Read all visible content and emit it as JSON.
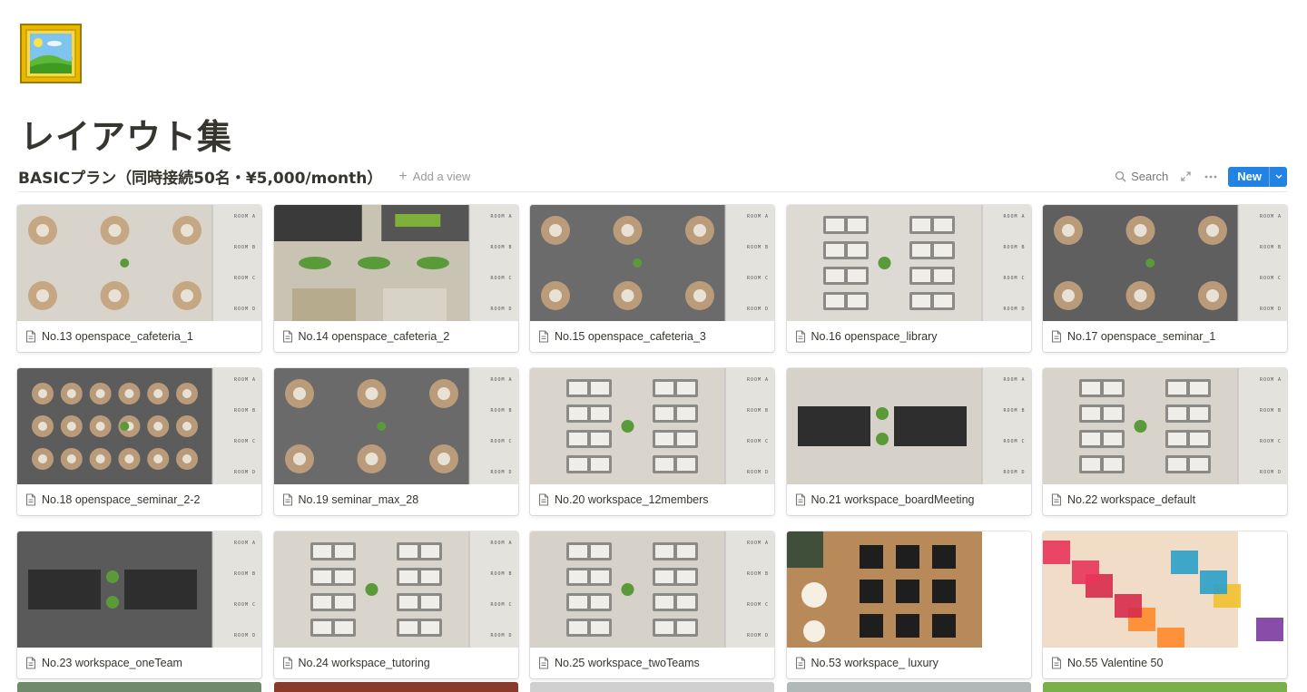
{
  "page": {
    "icon": "framed-picture-icon",
    "title": "レイアウト集"
  },
  "database": {
    "title": "BASICプラン（同時接続50名・¥5,000/month）",
    "add_view_label": "Add a view",
    "toolbar": {
      "search_label": "Search",
      "new_label": "New"
    }
  },
  "room_labels": [
    "ROOM A",
    "ROOM B",
    "ROOM C",
    "ROOM D"
  ],
  "cards": [
    {
      "title": "No.13 openspace_cafeteria_1",
      "floor": "#d8d4cb",
      "style": "tables"
    },
    {
      "title": "No.14 openspace_cafeteria_2",
      "floor": "#c9c3b3",
      "style": "lounge"
    },
    {
      "title": "No.15 openspace_cafeteria_3",
      "floor": "#6b6b6b",
      "style": "tables"
    },
    {
      "title": "No.16 openspace_library",
      "floor": "#dddad3",
      "style": "desks"
    },
    {
      "title": "No.17 openspace_seminar_1",
      "floor": "#5f5f5f",
      "style": "tables"
    },
    {
      "title": "No.18 openspace_seminar_2-2",
      "floor": "#5c5c5c",
      "style": "tables"
    },
    {
      "title": "No.19 seminar_max_28",
      "floor": "#6a6a6a",
      "style": "tables"
    },
    {
      "title": "No.20 workspace_12members",
      "floor": "#d9d5cc",
      "style": "desks"
    },
    {
      "title": "No.21 workspace_boardMeeting",
      "floor": "#d6d2c9",
      "style": "board"
    },
    {
      "title": "No.22 workspace_default",
      "floor": "#d8d4cb",
      "style": "desks"
    },
    {
      "title": "No.23 workspace_oneTeam",
      "floor": "#5a5a5a",
      "style": "board"
    },
    {
      "title": "No.24 workspace_tutoring",
      "floor": "#d9d5cc",
      "style": "desks"
    },
    {
      "title": "No.25 workspace_twoTeams",
      "floor": "#d6d2c9",
      "style": "desks"
    },
    {
      "title": "No.53 workspace_ luxury",
      "floor": "#b88a5a",
      "style": "luxury"
    },
    {
      "title": "No.55 Valentine 50",
      "floor": "#f1dcc8",
      "style": "valentine"
    }
  ],
  "colors": {
    "accent": "#2383e2",
    "text": "#37352f",
    "muted": "#9b9a97",
    "plant": "#5a9a3a",
    "table_wood": "#c4a27c"
  },
  "partial_row_colors": [
    "#6e8a6a",
    "#8a3a2a",
    "#d0d0d0",
    "#b0b8b8",
    "#7ab04a"
  ]
}
